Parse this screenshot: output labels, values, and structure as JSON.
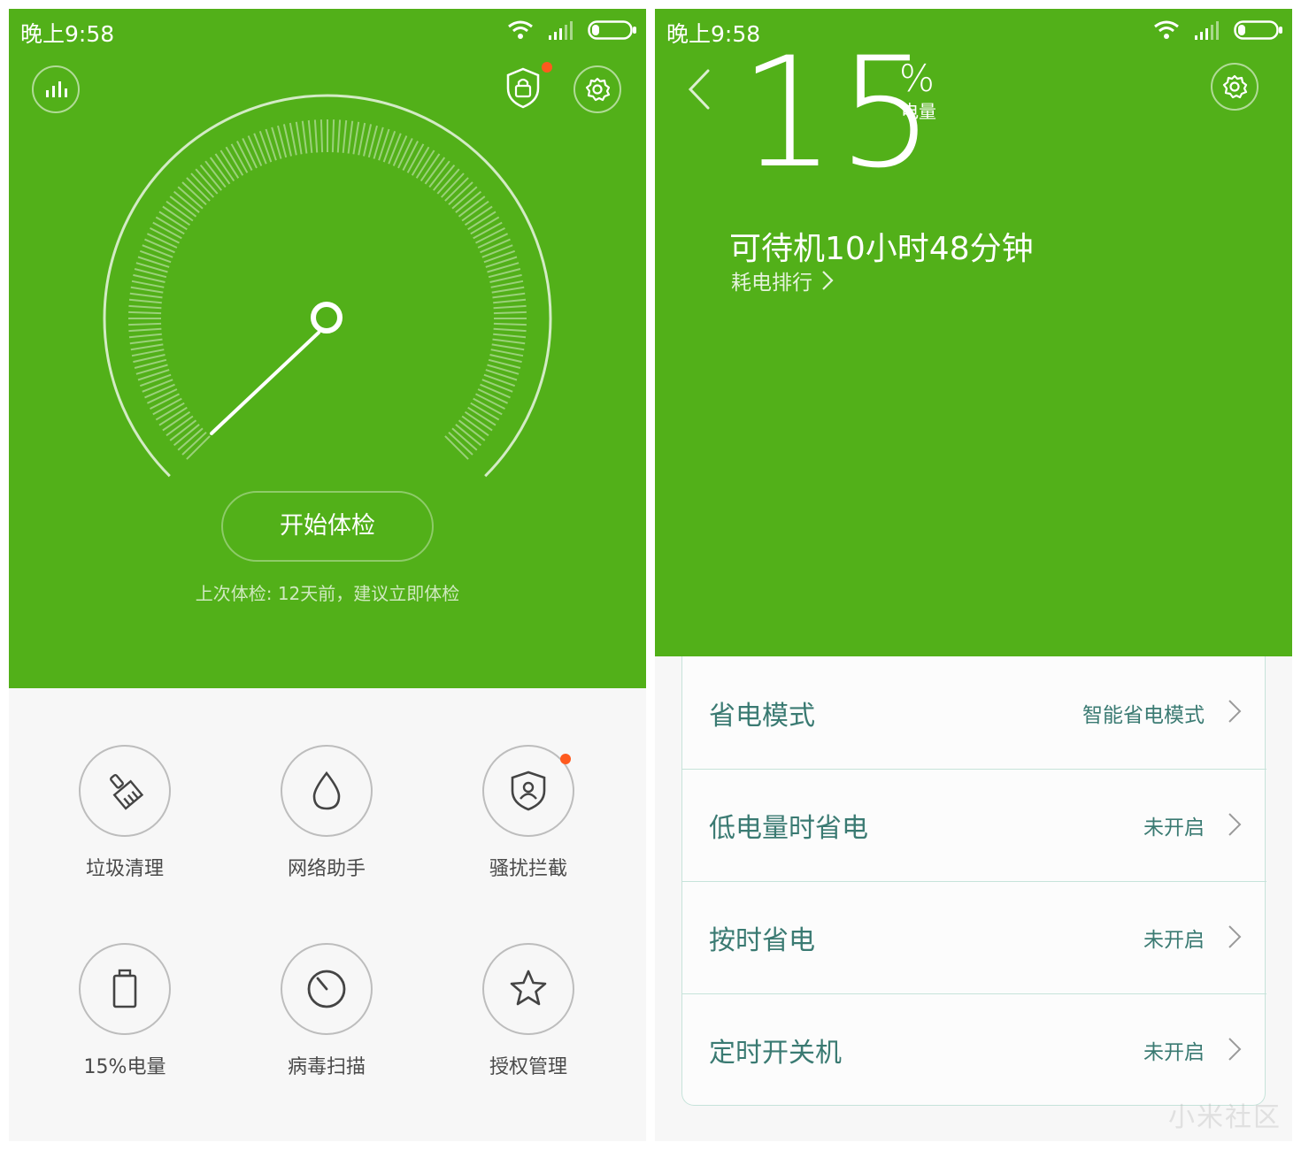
{
  "left": {
    "status": {
      "time": "晚上9:58"
    },
    "header": {
      "stats_icon": "bar-chart-icon",
      "shield_icon": "shield-lock-icon",
      "settings_icon": "gear-icon"
    },
    "main": {
      "start_button": "开始体检",
      "last_check": "上次体检: 12天前，建议立即体检"
    },
    "tools": [
      {
        "label": "垃圾清理",
        "icon": "broom-icon"
      },
      {
        "label": "网络助手",
        "icon": "drop-icon"
      },
      {
        "label": "骚扰拦截",
        "icon": "shield-user-icon"
      },
      {
        "label": "15%电量",
        "icon": "battery-icon"
      },
      {
        "label": "病毒扫描",
        "icon": "scan-icon"
      },
      {
        "label": "授权管理",
        "icon": "star-icon"
      }
    ]
  },
  "right": {
    "status": {
      "time": "晚上9:58"
    },
    "battery": {
      "level": "15",
      "unit": "%",
      "unit_label": "电量",
      "standby": "可待机10小时48分钟",
      "rank_link": "耗电排行"
    },
    "rows": [
      {
        "title": "省电模式",
        "value": "智能省电模式"
      },
      {
        "title": "低电量时省电",
        "value": "未开启"
      },
      {
        "title": "按时省电",
        "value": "未开启"
      },
      {
        "title": "定时开关机",
        "value": "未开启"
      }
    ],
    "watermark": "小米社区"
  },
  "colors": {
    "green": "#52b019",
    "badge": "#ff5a1e",
    "row_text": "#3a7a72",
    "bg": "#f7f7f7"
  }
}
